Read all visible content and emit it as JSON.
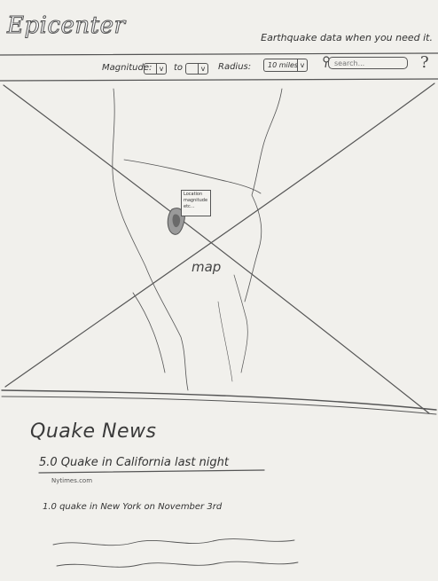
{
  "header": {
    "logo": "Epicenter",
    "tagline": "Earthquake data when you need it."
  },
  "toolbar": {
    "magnitude_label": "Magnitude:",
    "to_label": "to",
    "radius_label": "Radius:",
    "radius_value": "10 miles",
    "search_placeholder": "search...",
    "help_label": "?"
  },
  "map": {
    "label": "map",
    "popup_lines": [
      "Location",
      "magnitude",
      "etc..."
    ]
  },
  "news": {
    "title": "Quake News",
    "items": [
      {
        "headline": "5.0 Quake in California last night",
        "source": "Nytimes.com"
      },
      {
        "headline": "1.0 quake in New York on November 3rd"
      }
    ]
  }
}
